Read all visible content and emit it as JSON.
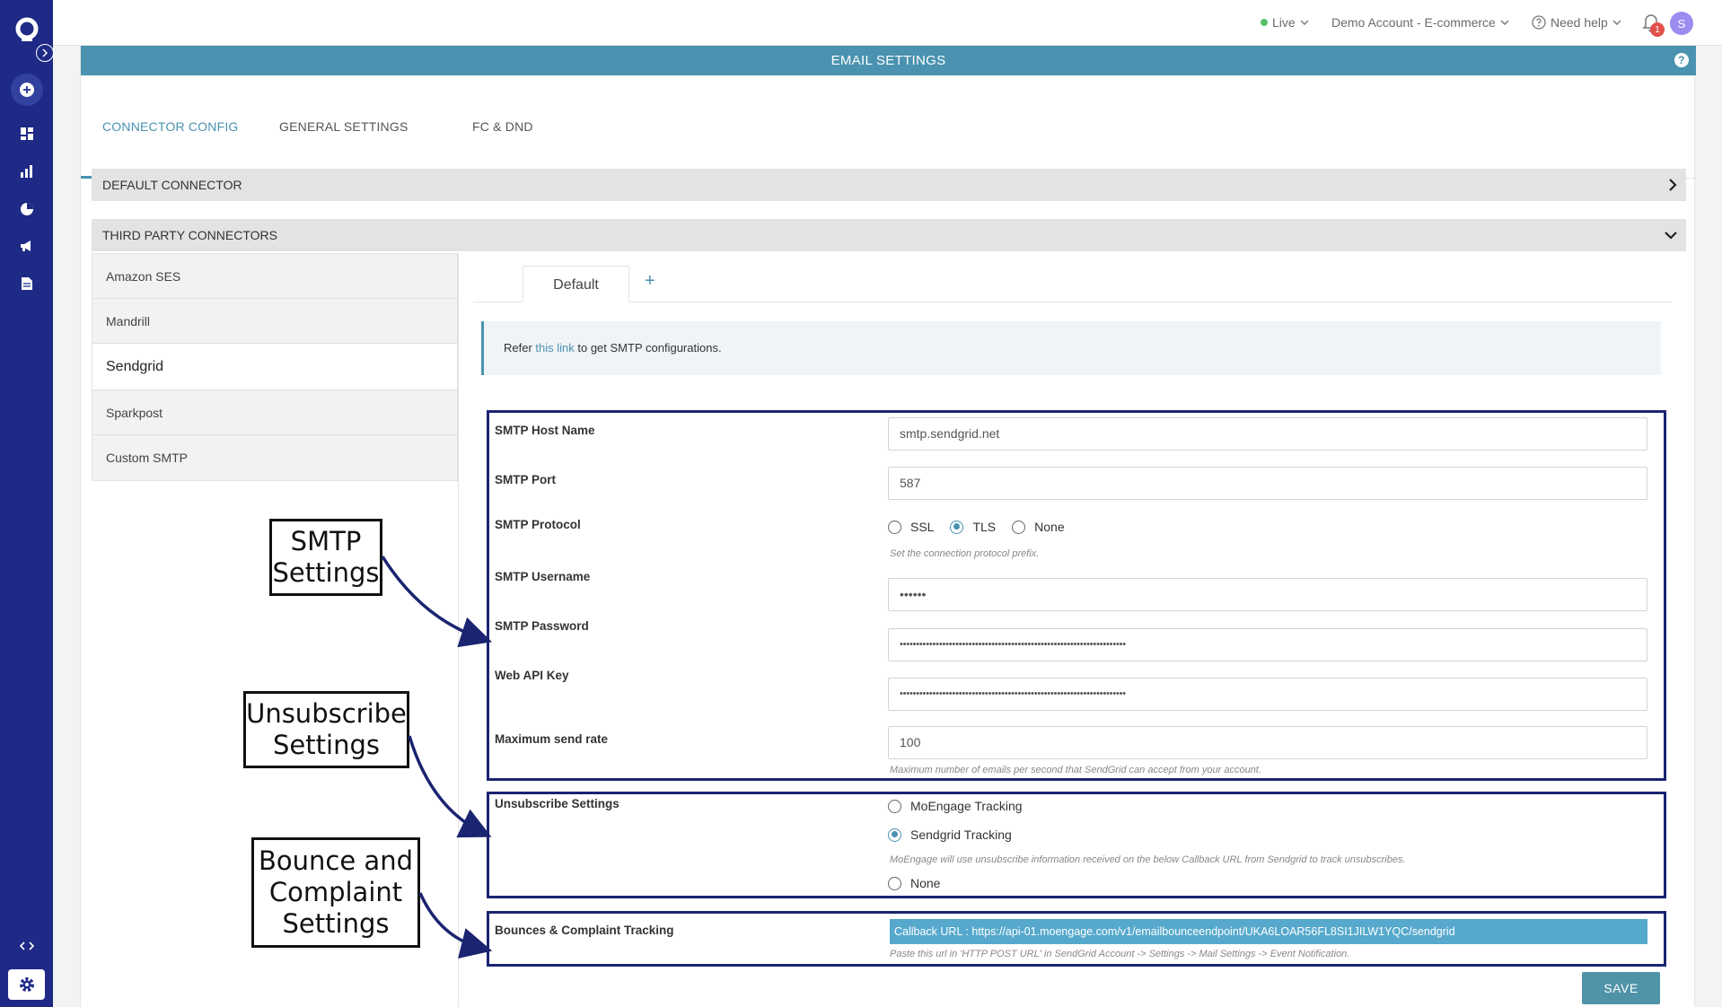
{
  "topbar": {
    "live_label": "Live",
    "account_label": "Demo Account - E-commerce",
    "help_label": "Need help",
    "notification_count": "1",
    "avatar_initial": "S"
  },
  "page": {
    "title": "EMAIL SETTINGS",
    "help_symbol": "?",
    "tabs": [
      {
        "label": "CONNECTOR CONFIG",
        "active": true
      },
      {
        "label": "GENERAL SETTINGS",
        "active": false
      },
      {
        "label": "FC & DND",
        "active": false
      }
    ]
  },
  "sections": {
    "default_connector": "DEFAULT CONNECTOR",
    "third_party_connectors": "THIRD PARTY CONNECTORS"
  },
  "connectors": [
    {
      "label": "Amazon SES",
      "active": false
    },
    {
      "label": "Mandrill",
      "active": false
    },
    {
      "label": "Sendgrid",
      "active": true
    },
    {
      "label": "Sparkpost",
      "active": false
    },
    {
      "label": "Custom SMTP",
      "active": false
    }
  ],
  "subtabs": {
    "default_label": "Default",
    "add_label": "+"
  },
  "info": {
    "prefix": "Refer ",
    "link": "this link",
    "suffix": " to get SMTP configurations."
  },
  "form": {
    "host_label": "SMTP Host Name",
    "host_value": "smtp.sendgrid.net",
    "port_label": "SMTP Port",
    "port_value": "587",
    "protocol_label": "SMTP Protocol",
    "protocol_options": [
      "SSL",
      "TLS",
      "None"
    ],
    "protocol_selected": "TLS",
    "protocol_hint": "Set the connection protocol prefix.",
    "username_label": "SMTP Username",
    "username_value": "••••••",
    "password_label": "SMTP Password",
    "password_value": "•••••••••••••••••••••••••••••••••••••••••••••••••••••••••••••••••••••",
    "apikey_label": "Web API Key",
    "apikey_value": "•••••••••••••••••••••••••••••••••••••••••••••••••••••••••••••••••••••",
    "maxrate_label": "Maximum send rate",
    "maxrate_value": "100",
    "maxrate_hint": "Maximum number of emails per second that SendGrid can accept from your account.",
    "unsub_label": "Unsubscribe Settings",
    "unsub_options": [
      "MoEngage Tracking",
      "Sendgrid Tracking",
      "None"
    ],
    "unsub_selected": "Sendgrid Tracking",
    "unsub_hint": "MoEngage will use unsubscribe information received on the below Callback URL from Sendgrid to track unsubscribes.",
    "bounce_label": "Bounces & Complaint Tracking",
    "callback_url": "Callback URL : https://api-01.moengage.com/v1/emailbounceendpoint/UKA6LOAR56FL8SI1JILW1YQC/sendgrid",
    "bounce_hint": "Paste this url in 'HTTP POST URL' in SendGrid Account -> Settings -> Mail Settings -> Event Notification.",
    "save_label": "SAVE"
  },
  "annotations": {
    "smtp_line1": "SMTP",
    "smtp_line2": "Settings",
    "unsub_line1": "Unsubscribe",
    "unsub_line2": "Settings",
    "bounce_line1": "Bounce and",
    "bounce_line2": "Complaint",
    "bounce_line3": "Settings"
  },
  "colors": {
    "sidebar": "#1f2a86",
    "accent": "#4a92b0",
    "annotation": "#1b2470"
  }
}
